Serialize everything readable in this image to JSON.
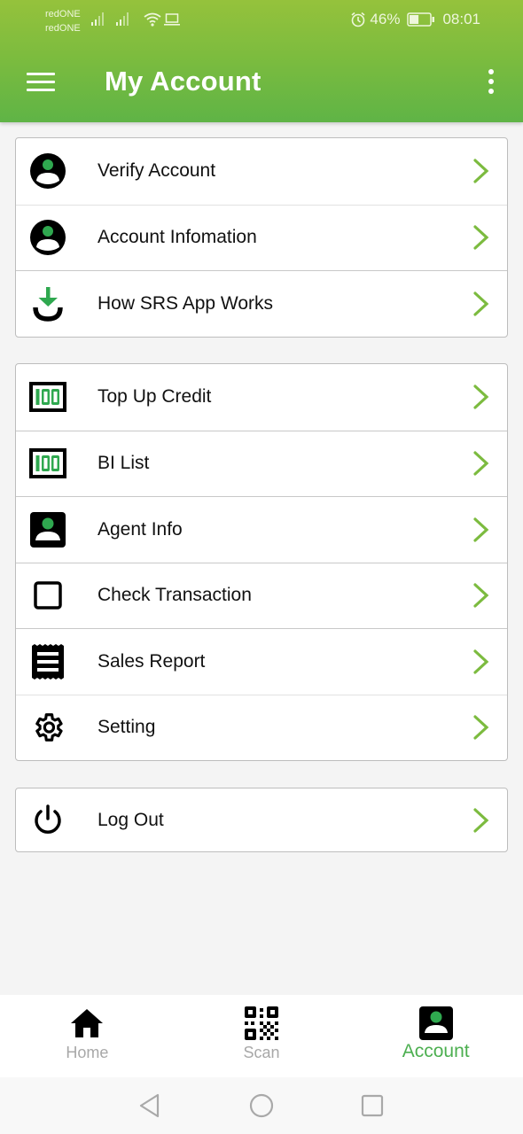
{
  "status_bar": {
    "carriers": [
      "redONE",
      "redONE"
    ],
    "battery_percent": "46%",
    "battery_level": 0.46,
    "time": "08:01",
    "icons": [
      "signal-icon",
      "signal-icon",
      "wifi-icon",
      "laptop-icon",
      "alarm-icon",
      "battery-icon"
    ]
  },
  "app_bar": {
    "title": "My Account",
    "menu_icon": "hamburger-menu-icon",
    "more_icon": "more-vertical-icon"
  },
  "colors": {
    "header_gradient_top": "#95c23c",
    "header_gradient_bottom": "#5fb446",
    "accent_green": "#4caf50",
    "chevron_green": "#7cbb3f",
    "icon_green": "#2fa84f"
  },
  "sections": [
    {
      "items": [
        {
          "label": "Verify Account",
          "icon": "user-circle-icon"
        },
        {
          "label": "Account Infomation",
          "icon": "user-circle-icon"
        },
        {
          "label": "How SRS App Works",
          "icon": "download-arrow-icon"
        }
      ]
    },
    {
      "items": [
        {
          "label": "Top Up Credit",
          "icon": "banknote-100-icon"
        },
        {
          "label": "BI List",
          "icon": "banknote-100-icon"
        },
        {
          "label": "Agent Info",
          "icon": "user-card-icon"
        },
        {
          "label": "Check Transaction",
          "icon": "square-outline-icon"
        },
        {
          "label": "Sales Report",
          "icon": "receipt-icon"
        },
        {
          "label": "Setting",
          "icon": "gear-icon"
        }
      ]
    },
    {
      "items": [
        {
          "label": "Log Out",
          "icon": "power-icon"
        }
      ]
    }
  ],
  "bottom_nav": {
    "items": [
      {
        "label": "Home",
        "icon": "home-icon",
        "active": false
      },
      {
        "label": "Scan",
        "icon": "qr-code-icon",
        "active": false
      },
      {
        "label": "Account",
        "icon": "user-card-icon",
        "active": true
      }
    ]
  },
  "system_nav": {
    "buttons": [
      "back-icon",
      "home-circle-icon",
      "recents-icon"
    ]
  }
}
